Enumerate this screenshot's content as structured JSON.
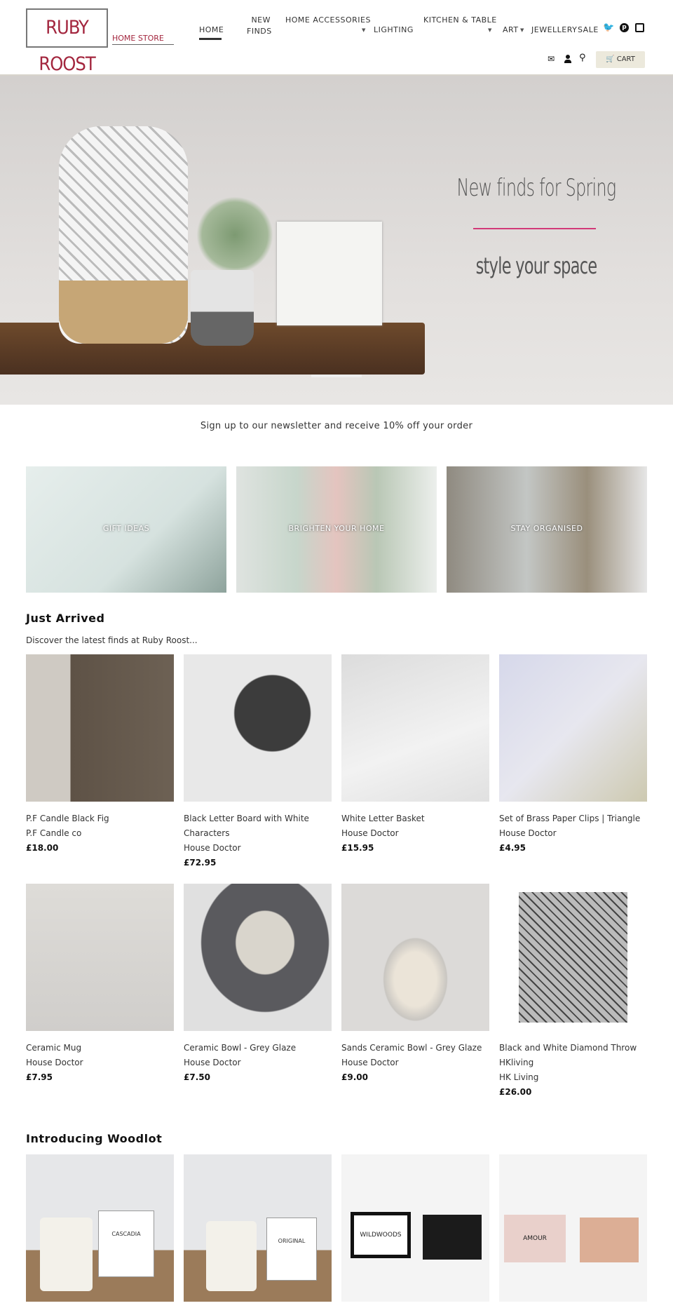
{
  "header": {
    "logo_text": "RUBY ROOST",
    "logo_subtext": "HOME STORE",
    "nav": [
      {
        "label": "HOME"
      },
      {
        "label": "NEW FINDS"
      },
      {
        "label": "HOME ACCESSORIES"
      },
      {
        "label": "LIGHTING"
      },
      {
        "label": "KITCHEN & TABLE"
      },
      {
        "label": "ART"
      },
      {
        "label": "JEWELLERY"
      },
      {
        "label": "SALE"
      }
    ],
    "social_icons": [
      "twitter-icon",
      "pinterest-icon",
      "instagram-icon"
    ],
    "utility_icons": [
      "mail-icon",
      "user-icon",
      "search-icon"
    ],
    "cart_label": "CART"
  },
  "hero": {
    "title": "New finds for Spring",
    "subtitle": "style your space",
    "accent_color": "#d23a78"
  },
  "newsletter": {
    "text": "Sign up to our newsletter and receive 10% off your order"
  },
  "categories": [
    {
      "label": "GIFT IDEAS"
    },
    {
      "label": "BRIGHTEN YOUR HOME"
    },
    {
      "label": "STAY ORGANISED"
    }
  ],
  "just_arrived": {
    "title": "Just Arrived",
    "subtitle": "Discover the latest finds at Ruby Roost...",
    "products": [
      {
        "name": "P.F Candle Black Fig",
        "brand": "P.F Candle co",
        "price": "£18.00"
      },
      {
        "name": "Black Letter Board with White Characters",
        "brand": "House Doctor",
        "price": "£72.95"
      },
      {
        "name": "White Letter Basket",
        "brand": "House Doctor",
        "price": "£15.95"
      },
      {
        "name": "Set of Brass Paper Clips | Triangle",
        "brand": "House Doctor",
        "price": "£4.95"
      },
      {
        "name": "Ceramic Mug",
        "brand": "House Doctor",
        "price": "£7.95"
      },
      {
        "name": "Ceramic Bowl - Grey Glaze",
        "brand": "House Doctor",
        "price": "£7.50"
      },
      {
        "name": "Sands Ceramic Bowl - Grey Glaze",
        "brand": "House Doctor",
        "price": "£9.00"
      },
      {
        "name": "Black and White Diamond Throw",
        "brand": "HKliving",
        "brand2": "HK Living",
        "price": "£26.00"
      }
    ]
  },
  "woodlot": {
    "title": "Introducing Woodlot",
    "products": [
      {
        "label": "CASCADIA"
      },
      {
        "label": "ORIGINAL"
      },
      {
        "label": "WILDWOODS"
      },
      {
        "label": "AMOUR"
      }
    ]
  }
}
